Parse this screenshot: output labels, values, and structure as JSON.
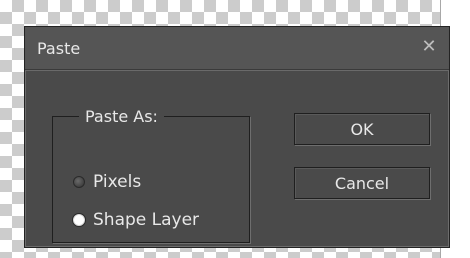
{
  "dialog": {
    "title": "Paste",
    "close_glyph": "✕",
    "group_label": "Paste As:",
    "options": [
      {
        "label": "Pixels",
        "selected": false
      },
      {
        "label": "Shape Layer",
        "selected": true
      }
    ],
    "ok_label": "OK",
    "cancel_label": "Cancel"
  },
  "colors": {
    "dialog_bg": "#4a4a4a",
    "text": "#e8e8e8",
    "border_dark": "#1f1f1f"
  },
  "icons": {
    "close": "close-icon",
    "radio_off": "radio-unselected-icon",
    "radio_on": "radio-selected-icon"
  }
}
